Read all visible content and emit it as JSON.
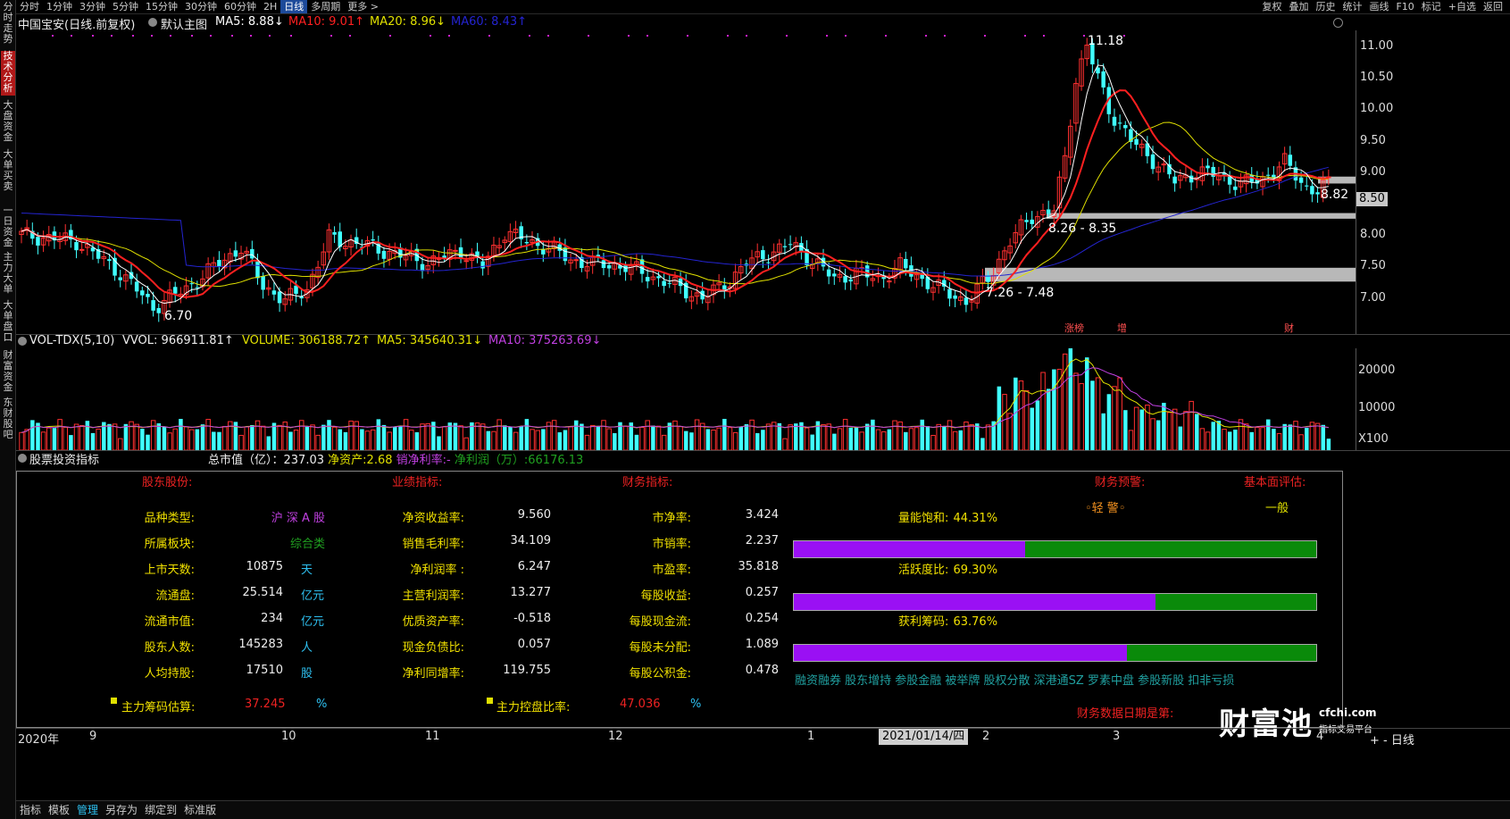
{
  "left_sidebar": [
    "分时走势",
    "技术分析",
    "大盘资金",
    "大单买卖",
    "一日资金",
    "主力大单",
    "大单盘口",
    "财富资金",
    "东财股吧"
  ],
  "top_toolbar": {
    "periods": [
      "分时",
      "1分钟",
      "3分钟",
      "5分钟",
      "15分钟",
      "30分钟",
      "60分钟",
      "2H",
      "日线",
      "多周期",
      "更多 >"
    ],
    "selected": "日线",
    "tools": [
      "复权",
      "叠加",
      "历史",
      "统计",
      "画线",
      "F10",
      "标记",
      "+自选",
      "返回"
    ]
  },
  "main_chart": {
    "stock_name": "中国宝安(日线.前复权)",
    "main_label": "默认主图",
    "ma5": "MA5: 8.88↓",
    "ma10": "MA10: 9.01↑",
    "ma20": "MA20: 8.96↓",
    "ma60": "MA60: 8.43↑",
    "price_ticks": [
      "11.00",
      "10.50",
      "10.00",
      "9.50",
      "9.00",
      "8.50",
      "8.00",
      "7.50",
      "7.00"
    ],
    "current_price": "8.50",
    "annotations": [
      "11.18",
      "6.70",
      "8.82",
      "8.26 - 8.35",
      "7.26 - 7.48"
    ],
    "event_tags": [
      "涨榜",
      "增",
      "财"
    ],
    "colors": {
      "ma5": "#ffffff",
      "ma10": "#ff2020",
      "ma20": "#e0e000",
      "ma60": "#2424d0",
      "up": "#ff3030",
      "down": "#40ffff",
      "zone": "#b8b8b8"
    }
  },
  "volume_chart": {
    "label": "VOL-TDX(5,10)",
    "vvol": "VVOL: 966911.81↑",
    "volume": "VOLUME: 306188.72↑",
    "ma5": "MA5: 345640.31↓",
    "ma10": "MA10: 375263.69↓",
    "ticks": [
      "20000",
      "10000",
      "X100"
    ]
  },
  "indicator_panel": {
    "title": "股票投资指标",
    "summary": {
      "mcap_label": "总市值（亿）：",
      "mcap": "237.03",
      "nav_label": "净资产:",
      "nav": "2.68",
      "npm_label": "销净利率:",
      "npm": "-",
      "np_label": "净利润（万）:",
      "np": "66176.13"
    },
    "sections": {
      "shareholder": "股东股份:",
      "performance": "业绩指标:",
      "finance": "财务指标:",
      "warning": "财务预警:",
      "eval": "基本面评估:"
    },
    "col1": [
      {
        "label": "品种类型:",
        "value": "沪 深 A 股",
        "unit": ""
      },
      {
        "label": "所属板块:",
        "value": "综合类",
        "unit": ""
      },
      {
        "label": "上市天数:",
        "value": "10875",
        "unit": "天"
      },
      {
        "label": "流通盘:",
        "value": "25.514",
        "unit": "亿元"
      },
      {
        "label": "流通市值:",
        "value": "234",
        "unit": "亿元"
      },
      {
        "label": "股东人数:",
        "value": "145283",
        "unit": "人"
      },
      {
        "label": "人均持股:",
        "value": "17510",
        "unit": "股"
      }
    ],
    "col2": [
      {
        "label": "净资收益率:",
        "value": "9.560"
      },
      {
        "label": "销售毛利率:",
        "value": "34.109"
      },
      {
        "label": "净利润率 :",
        "value": "6.247"
      },
      {
        "label": "主营利润率:",
        "value": "13.277"
      },
      {
        "label": "优质资产率:",
        "value": "-0.518"
      },
      {
        "label": "现金负债比:",
        "value": "0.057"
      },
      {
        "label": "净利同增率:",
        "value": "119.755"
      }
    ],
    "col3": [
      {
        "label": "市净率:",
        "value": "3.424"
      },
      {
        "label": "市销率:",
        "value": "2.237"
      },
      {
        "label": "市盈率:",
        "value": "35.818"
      },
      {
        "label": "每股收益:",
        "value": "0.257"
      },
      {
        "label": "每股现金流:",
        "value": "0.254"
      },
      {
        "label": "每股未分配:",
        "value": "1.089"
      },
      {
        "label": "每股公积金:",
        "value": "0.478"
      }
    ],
    "warning_value": "◦轻 警◦",
    "eval_value": "一般",
    "meters": [
      {
        "label": "量能饱和:",
        "value": "44.31%",
        "fraction": 0.4431
      },
      {
        "label": "活跃度比:",
        "value": "69.30%",
        "fraction": 0.693
      },
      {
        "label": "获利筹码:",
        "value": "63.76%",
        "fraction": 0.6376
      }
    ],
    "concepts": "融资融券 股东增持 参股金融 被举牌 股权分散 深港通SZ 罗素中盘 参股新股 扣非亏损",
    "chip_est_label": "主力筹码估算:",
    "chip_est": "37.245",
    "chip_unit": "%",
    "ctrl_label": "主力控盘比率:",
    "ctrl": "47.036",
    "ctrl_unit": "%",
    "date_label": "财务数据日期是第:"
  },
  "time_axis": {
    "year": "2020年",
    "months": [
      "9",
      "10",
      "11",
      "12",
      "1",
      "2",
      "3",
      "4"
    ],
    "cursor_date": "2021/01/14/四"
  },
  "watermark": {
    "brand": "财富池",
    "site": "cfchi.com",
    "slogan": "指标交易平台"
  },
  "bottom_bar": {
    "items": [
      "指标",
      "模板",
      "管理",
      "另存为",
      "绑定到",
      "标准版"
    ],
    "selected": "管理"
  }
}
